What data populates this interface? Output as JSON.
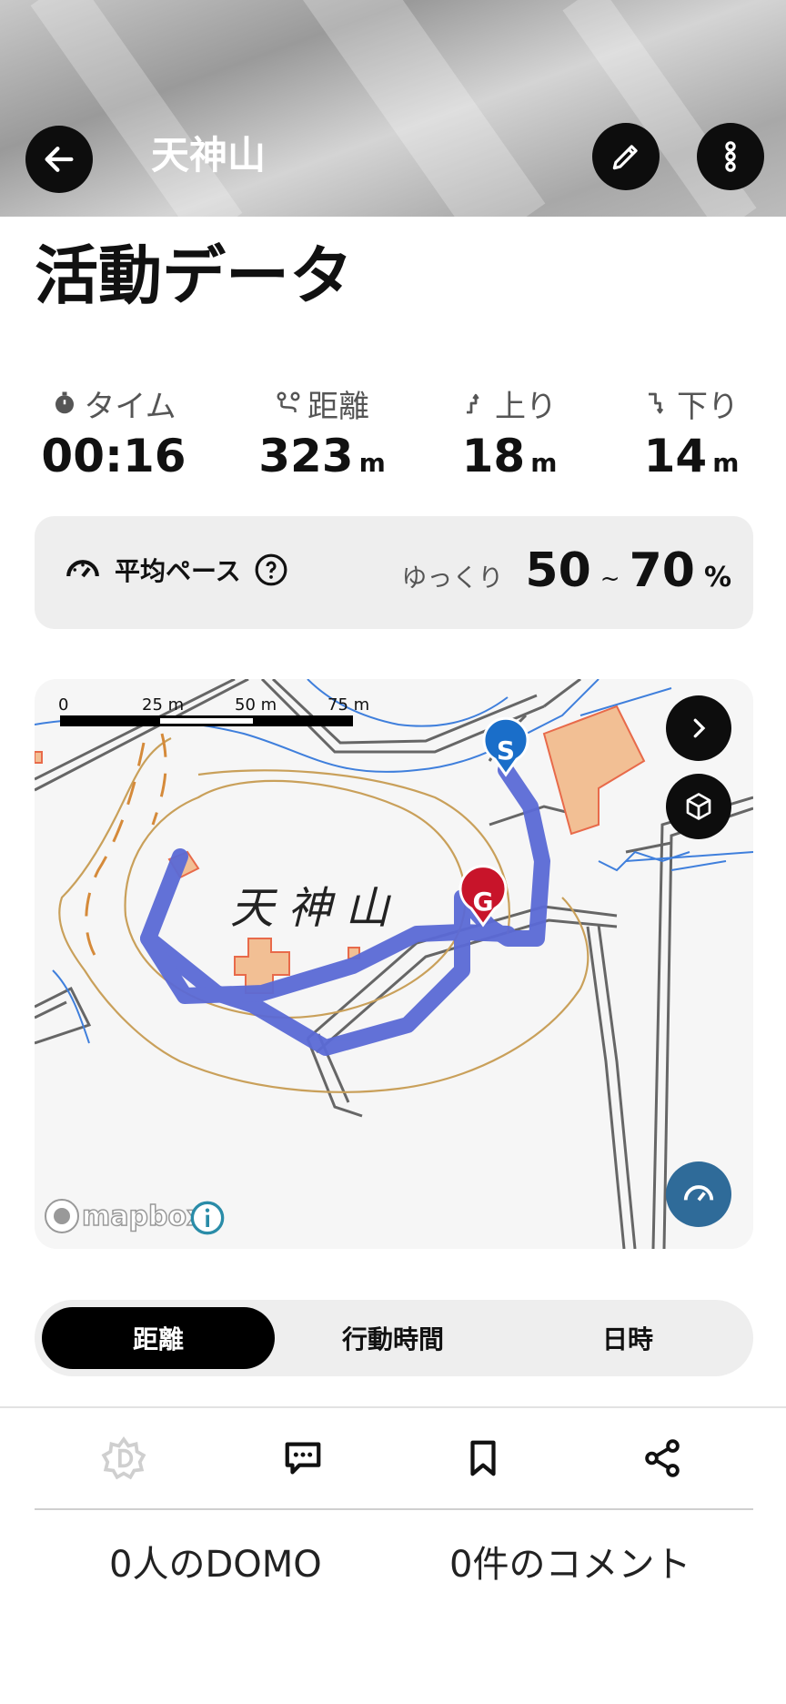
{
  "header": {
    "title": "天神山"
  },
  "section_title": "活動データ",
  "stats": [
    {
      "label": "タイム",
      "value": "00:16",
      "unit": ""
    },
    {
      "label": "距離",
      "value": "323",
      "unit": "m"
    },
    {
      "label": "上り",
      "value": "18",
      "unit": "m"
    },
    {
      "label": "下り",
      "value": "14",
      "unit": "m"
    }
  ],
  "pace": {
    "label": "平均ペース",
    "speed_word": "ゆっくり",
    "low": "50",
    "tilde": "~",
    "high": "70",
    "unit": "%"
  },
  "map": {
    "scale_labels": [
      "0",
      "25 m",
      "50 m",
      "75 m"
    ],
    "place_name": "天 神 山",
    "attribution": "mapbox",
    "start_marker": "S",
    "goal_marker": "G",
    "route_color": "#5b6ad6"
  },
  "segment": {
    "options": [
      "距離",
      "行動時間",
      "日時"
    ],
    "selected": "距離"
  },
  "footer": {
    "domo_count": "0人のDOMO",
    "comment_count": "0件のコメント"
  }
}
